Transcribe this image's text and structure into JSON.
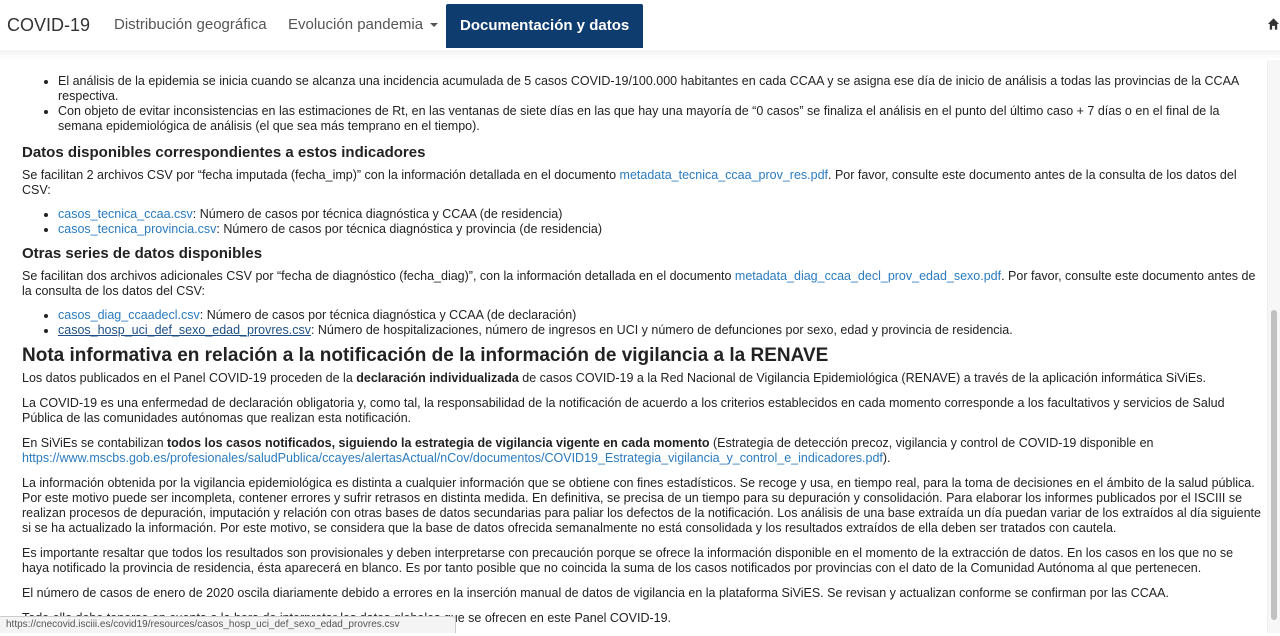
{
  "navbar": {
    "brand": "COVID-19",
    "items": [
      {
        "label": "Distribución geográfica"
      },
      {
        "label": "Evolución pandemia"
      },
      {
        "label": "Documentación y datos"
      }
    ],
    "active_color": "#0f3c6e"
  },
  "top_bullets": [
    "El análisis de la epidemia se inicia cuando se alcanza una incidencia acumulada de 5 casos COVID-19/100.000 habitantes en cada CCAA y se asigna ese día de inicio de análisis a todas las provincias de la CCAA respectiva.",
    "Con objeto de evitar inconsistencias en las estimaciones de Rt, en las ventanas de siete días en las que hay una mayoría de “0 casos” se finaliza el análisis en el punto del último caso + 7 días o en el final de la semana epidemiológica de análisis (el que sea más temprano en el tiempo)."
  ],
  "section1": {
    "heading": "Datos disponibles correspondientes a estos indicadores",
    "para_before": "Se facilitan 2 archivos CSV por “fecha imputada (fecha_imp)” con la información detallada en el documento ",
    "link": "metadata_tecnica_ccaa_prov_res.pdf",
    "para_after": ". Por favor, consulte este documento antes de la consulta de los datos del CSV:",
    "files": [
      {
        "link": "casos_tecnica_ccaa.csv",
        "desc": ": Número de casos por técnica diagnóstica y CCAA (de residencia)"
      },
      {
        "link": "casos_tecnica_provincia.csv",
        "desc": ": Número de casos por técnica diagnóstica y provincia (de residencia)"
      }
    ]
  },
  "section2": {
    "heading": "Otras series de datos disponibles",
    "para_before": "Se facilitan dos archivos adicionales CSV por “fecha de diagnóstico (fecha_diag)”, con la información detallada en el documento ",
    "link": "metadata_diag_ccaa_decl_prov_edad_sexo.pdf",
    "para_after": ". Por favor, consulte este documento antes de la consulta de los datos del CSV:",
    "files": [
      {
        "link": "casos_diag_ccaadecl.csv",
        "desc": ": Número de casos por técnica diagnóstica y CCAA (de declaración)"
      },
      {
        "link": "casos_hosp_uci_def_sexo_edad_provres.csv",
        "desc": ": Número de hospitalizaciones, número de ingresos en UCI y número de defunciones por sexo, edad y provincia de residencia."
      }
    ]
  },
  "nota": {
    "heading": "Nota informativa en relación a la notificación de la información de vigilancia a la RENAVE",
    "p1_before": "Los datos publicados en el Panel COVID-19 proceden de la ",
    "p1_bold": "declaración individualizada",
    "p1_after": " de casos COVID-19 a la Red Nacional de Vigilancia Epidemiológica (RENAVE) a través de la aplicación informática SiViEs.",
    "p2": "La COVID-19 es una enfermedad de declaración obligatoria y, como tal, la responsabilidad de la notificación de acuerdo a los criterios establecidos en cada momento corresponde a los facultativos y servicios de Salud Pública de las comunidades autónomas que realizan esta notificación.",
    "p3_before": "En SiViEs se contabilizan ",
    "p3_bold": "todos los casos notificados, siguiendo la estrategia de vigilancia vigente en cada momento",
    "p3_after": " (Estrategia de detección precoz, vigilancia y control de COVID-19 disponible en ",
    "p3_link": "https://www.mscbs.gob.es/profesionales/saludPublica/ccayes/alertasActual/nCov/documentos/COVID19_Estrategia_vigilancia_y_control_e_indicadores.pdf",
    "p3_end": ").",
    "p4": "La información obtenida por la vigilancia epidemiológica es distinta a cualquier información que se obtiene con fines estadísticos. Se recoge y usa, en tiempo real, para la toma de decisiones en el ámbito de la salud pública. Por este motivo puede ser incompleta, contener errores y sufrir retrasos en distinta medida. En definitiva, se precisa de un tiempo para su depuración y consolidación. Para elaborar los informes publicados por el ISCIII se realizan procesos de depuración, imputación y relación con otras bases de datos secundarias para paliar los defectos de la notificación. Los análisis de una base extraída un día puedan variar de los extraídos al día siguiente si se ha actualizado la información. Por este motivo, se considera que la base de datos ofrecida semanalmente no está consolidada y los resultados extraídos de ella deben ser tratados con cautela.",
    "p5": "Es importante resaltar que todos los resultados son provisionales y deben interpretarse con precaución porque se ofrece la información disponible en el momento de la extracción de datos. En los casos en los que no se haya notificado la provincia de residencia, ésta aparecerá en blanco. Es por tanto posible que no coincida la suma de los casos notificados por provincias con el dato de la Comunidad Autónoma al que pertenecen.",
    "p6": "El número de casos de enero de 2020 oscila diariamente debido a errores en la inserción manual de datos de vigilancia en la plataforma SiViES. Se revisan y actualizan conforme se confirman por las CCAA.",
    "p7": "Todo ello debe tenerse en cuenta a la hora de interpretar los datos globales que se ofrecen en este Panel COVID-19."
  },
  "status_bar": {
    "url": "https://cnecovid.isciii.es/covid19/resources/casos_hosp_uci_def_sexo_edad_provres.csv"
  }
}
